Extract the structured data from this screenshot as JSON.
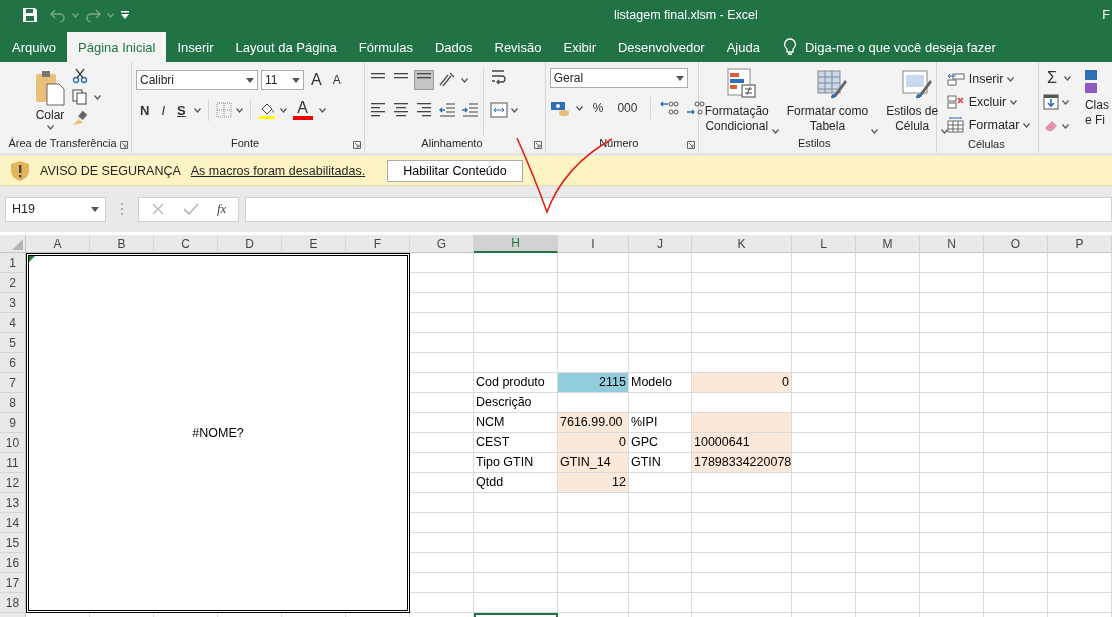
{
  "window": {
    "title": "listagem final.xlsm  -  Excel",
    "account": "F"
  },
  "tabs": [
    {
      "label": "Arquivo",
      "selected": false
    },
    {
      "label": "Página Inicial",
      "selected": true
    },
    {
      "label": "Inserir",
      "selected": false
    },
    {
      "label": "Layout da Página",
      "selected": false
    },
    {
      "label": "Fórmulas",
      "selected": false
    },
    {
      "label": "Dados",
      "selected": false
    },
    {
      "label": "Revisão",
      "selected": false
    },
    {
      "label": "Exibir",
      "selected": false
    },
    {
      "label": "Desenvolvedor",
      "selected": false
    },
    {
      "label": "Ajuda",
      "selected": false
    }
  ],
  "tell_me": "Diga-me o que você deseja fazer",
  "ribbon": {
    "clipboard": {
      "paste": "Colar",
      "label": "Área de Transferência"
    },
    "font": {
      "name": "Calibri",
      "size": "11",
      "grow": "A",
      "shrink": "A",
      "bold": "N",
      "italic": "I",
      "underline": "S",
      "font_color": "A",
      "label": "Fonte"
    },
    "alignment": {
      "label": "Alinhamento"
    },
    "number": {
      "format": "Geral",
      "percent": "%",
      "thousands": "000",
      "label": "Número"
    },
    "styles": {
      "buttons": [
        {
          "lines": [
            "Formatação",
            "Condicional"
          ]
        },
        {
          "lines": [
            "Formatar como",
            "Tabela"
          ]
        },
        {
          "lines": [
            "Estilos de",
            "Célula"
          ]
        }
      ],
      "label": "Estilos"
    },
    "cells": {
      "buttons": [
        "Inserir",
        "Excluir",
        "Formatar"
      ],
      "label": "Células"
    },
    "editing": {
      "sum": "Σ",
      "lines": [
        "Clas",
        "e Fi"
      ]
    }
  },
  "security_bar": {
    "title": "AVISO DE SEGURANÇA",
    "message": "As macros foram desabilitadas.",
    "button": "Habilitar Conteúdo"
  },
  "formula_bar": {
    "name_box": "H19",
    "function_label": "fx"
  },
  "sheet": {
    "columns": [
      {
        "label": "A",
        "selected": false
      },
      {
        "label": "B",
        "selected": false
      },
      {
        "label": "C",
        "selected": false
      },
      {
        "label": "D",
        "selected": false
      },
      {
        "label": "E",
        "selected": false
      },
      {
        "label": "F",
        "selected": false
      },
      {
        "label": "G",
        "selected": false
      },
      {
        "label": "H",
        "selected": true
      },
      {
        "label": "I",
        "selected": false
      },
      {
        "label": "J",
        "selected": false
      },
      {
        "label": "K",
        "selected": false
      },
      {
        "label": "L",
        "selected": false
      },
      {
        "label": "M",
        "selected": false
      },
      {
        "label": "N",
        "selected": false
      },
      {
        "label": "O",
        "selected": false
      },
      {
        "label": "P",
        "selected": false
      }
    ],
    "rows": [
      "1",
      "2",
      "3",
      "4",
      "5",
      "6",
      "7",
      "8",
      "9",
      "10",
      "11",
      "12",
      "13",
      "14",
      "15",
      "16",
      "17",
      "18"
    ],
    "merged_cell": {
      "text": "#NOME?"
    },
    "table": [
      [
        {
          "text": "Cod produto",
          "kind": "text"
        },
        {
          "text": "2115",
          "kind": "number",
          "color": "#92cddc"
        },
        {
          "text": "Modelo",
          "kind": "text"
        },
        {
          "text": "0",
          "kind": "number",
          "color": "#fde9d9"
        }
      ],
      [
        {
          "text": "Descrição",
          "kind": "text"
        }
      ],
      [
        {
          "text": "NCM",
          "kind": "text"
        },
        {
          "text": "7616.99.00",
          "kind": "text",
          "color": "#fde9d9"
        },
        {
          "text": "%IPI",
          "kind": "text"
        },
        {
          "color": "#fde9d9"
        }
      ],
      [
        {
          "text": "CEST",
          "kind": "text"
        },
        {
          "text": "0",
          "kind": "number",
          "color": "#fde9d9"
        },
        {
          "text": "GPC",
          "kind": "text"
        },
        {
          "text": "10000641",
          "kind": "text",
          "color": "#fde9d9"
        }
      ],
      [
        {
          "text": "Tipo GTIN",
          "kind": "text"
        },
        {
          "text": "GTIN_14",
          "kind": "text",
          "color": "#fde9d9"
        },
        {
          "text": "GTIN",
          "kind": "text"
        },
        {
          "text": "17898334220078",
          "kind": "text",
          "color": "#fde9d9"
        }
      ],
      [
        {
          "text": "Qtdd",
          "kind": "text"
        },
        {
          "text": "12",
          "kind": "number",
          "color": "#fde9d9"
        }
      ]
    ]
  }
}
